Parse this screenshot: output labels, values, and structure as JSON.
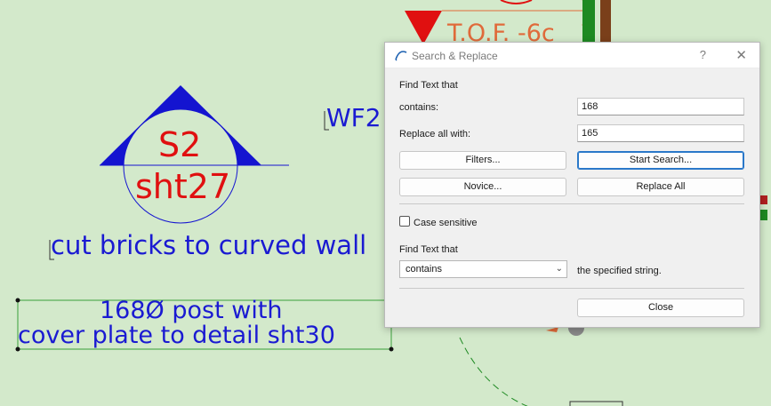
{
  "drawing": {
    "label_tof": "T.O.F. -6c",
    "label_wf": "WF2",
    "section_marker_top": "S2",
    "section_marker_bottom": "sht27",
    "note_bricks": "cut bricks to curved wall",
    "note_post_line1": "168Ø post with",
    "note_post_line2": "cover plate to detail sht30",
    "colors": {
      "text_blue": "#1a1ad2",
      "text_red": "#e01010",
      "background": "#d3e9cb"
    }
  },
  "dialog": {
    "title": "Search & Replace",
    "help_label": "?",
    "close_label": "✕",
    "find_text_heading": "Find Text that",
    "contains_label": "contains:",
    "contains_value": "168",
    "replace_label": "Replace all with:",
    "replace_value": "165",
    "filters_button": "Filters...",
    "start_search_button": "Start Search...",
    "novice_button": "Novice...",
    "replace_all_button": "Replace All",
    "case_sensitive_label": "Case sensitive",
    "find_text_heading2": "Find Text that",
    "mode_select_value": "contains",
    "mode_suffix": "the specified string.",
    "close_button": "Close"
  }
}
